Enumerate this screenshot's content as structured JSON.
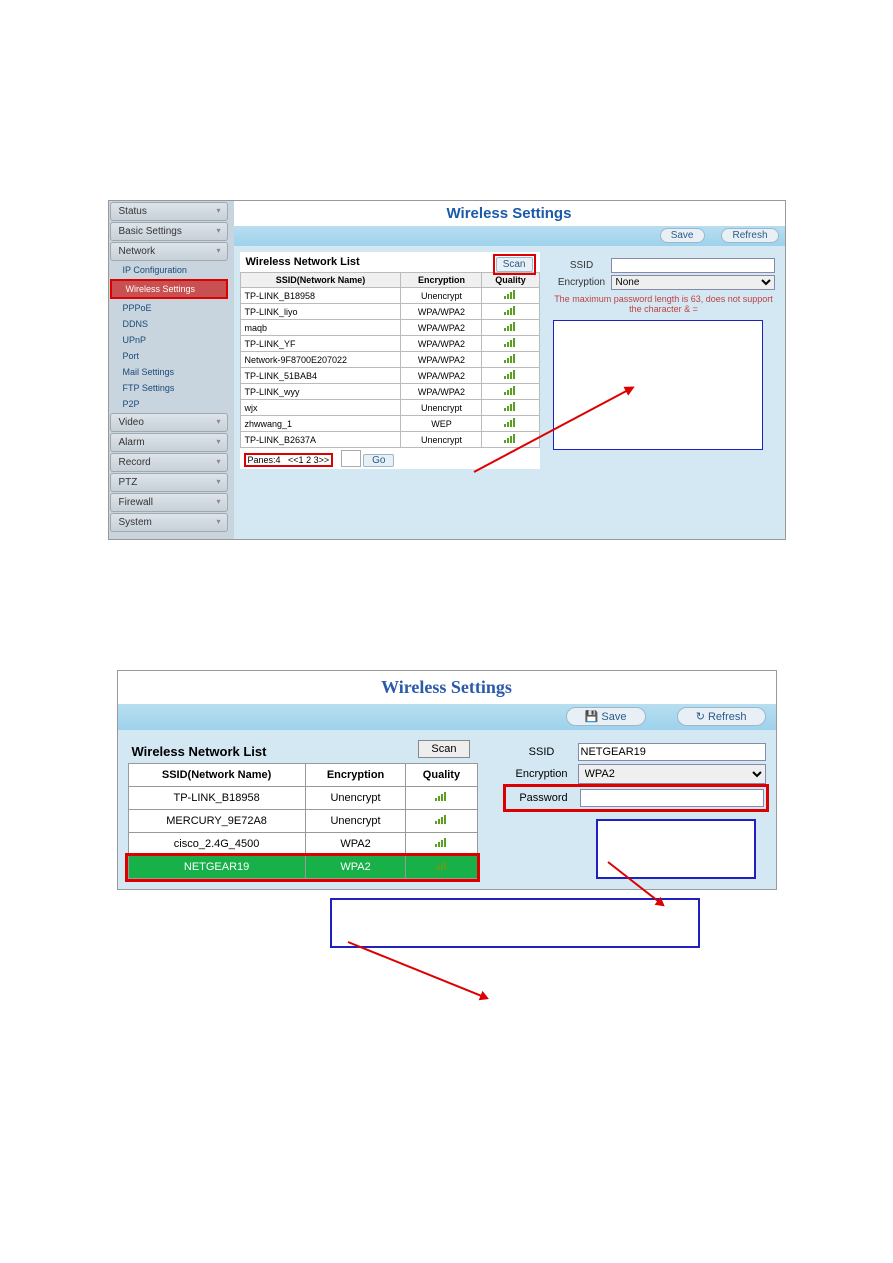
{
  "screenshot1": {
    "sidebar": {
      "status": "Status",
      "basic": "Basic Settings",
      "network": "Network",
      "subs": {
        "ip": "IP Configuration",
        "wireless": "Wireless Settings",
        "pppoe": "PPPoE",
        "ddns": "DDNS",
        "upnp": "UPnP",
        "port": "Port",
        "mail": "Mail Settings",
        "ftp": "FTP Settings",
        "p2p": "P2P"
      },
      "video": "Video",
      "alarm": "Alarm",
      "record": "Record",
      "ptz": "PTZ",
      "firewall": "Firewall",
      "system": "System"
    },
    "title": "Wireless Settings",
    "buttons": {
      "save": "Save",
      "refresh": "Refresh",
      "scan": "Scan",
      "go": "Go"
    },
    "list_heading": "Wireless Network List",
    "cols": {
      "ssid": "SSID(Network Name)",
      "enc": "Encryption",
      "qual": "Quality"
    },
    "networks": [
      {
        "ssid": "TP-LINK_B18958",
        "enc": "Unencrypt"
      },
      {
        "ssid": "TP-LINK_liyo",
        "enc": "WPA/WPA2"
      },
      {
        "ssid": "maqb",
        "enc": "WPA/WPA2"
      },
      {
        "ssid": "TP-LINK_YF",
        "enc": "WPA/WPA2"
      },
      {
        "ssid": "Network-9F8700E207022",
        "enc": "WPA/WPA2"
      },
      {
        "ssid": "TP-LINK_51BAB4",
        "enc": "WPA/WPA2"
      },
      {
        "ssid": "TP-LINK_wyy",
        "enc": "WPA/WPA2"
      },
      {
        "ssid": "wjx",
        "enc": "Unencrypt"
      },
      {
        "ssid": "zhwwang_1",
        "enc": "WEP"
      },
      {
        "ssid": "TP-LINK_B2637A",
        "enc": "Unencrypt"
      }
    ],
    "pager": {
      "pages": "Panes:4",
      "links": "<<1 2 3>>"
    },
    "form": {
      "ssid_label": "SSID",
      "ssid_value": "",
      "enc_label": "Encryption",
      "enc_value": "None",
      "hint": "The maximum password length is 63, does not support the character & ="
    }
  },
  "screenshot2": {
    "title": "Wireless Settings",
    "buttons": {
      "save": "Save",
      "refresh": "Refresh",
      "scan": "Scan"
    },
    "list_heading": "Wireless Network List",
    "cols": {
      "ssid": "SSID(Network Name)",
      "enc": "Encryption",
      "qual": "Quality"
    },
    "networks": [
      {
        "ssid": "TP-LINK_B18958",
        "enc": "Unencrypt"
      },
      {
        "ssid": "MERCURY_9E72A8",
        "enc": "Unencrypt"
      },
      {
        "ssid": "cisco_2.4G_4500",
        "enc": "WPA2"
      },
      {
        "ssid": "NETGEAR19",
        "enc": "WPA2"
      }
    ],
    "form": {
      "ssid_label": "SSID",
      "ssid_value": "NETGEAR19",
      "enc_label": "Encryption",
      "enc_value": "WPA2",
      "pw_label": "Password",
      "pw_value": ""
    }
  }
}
